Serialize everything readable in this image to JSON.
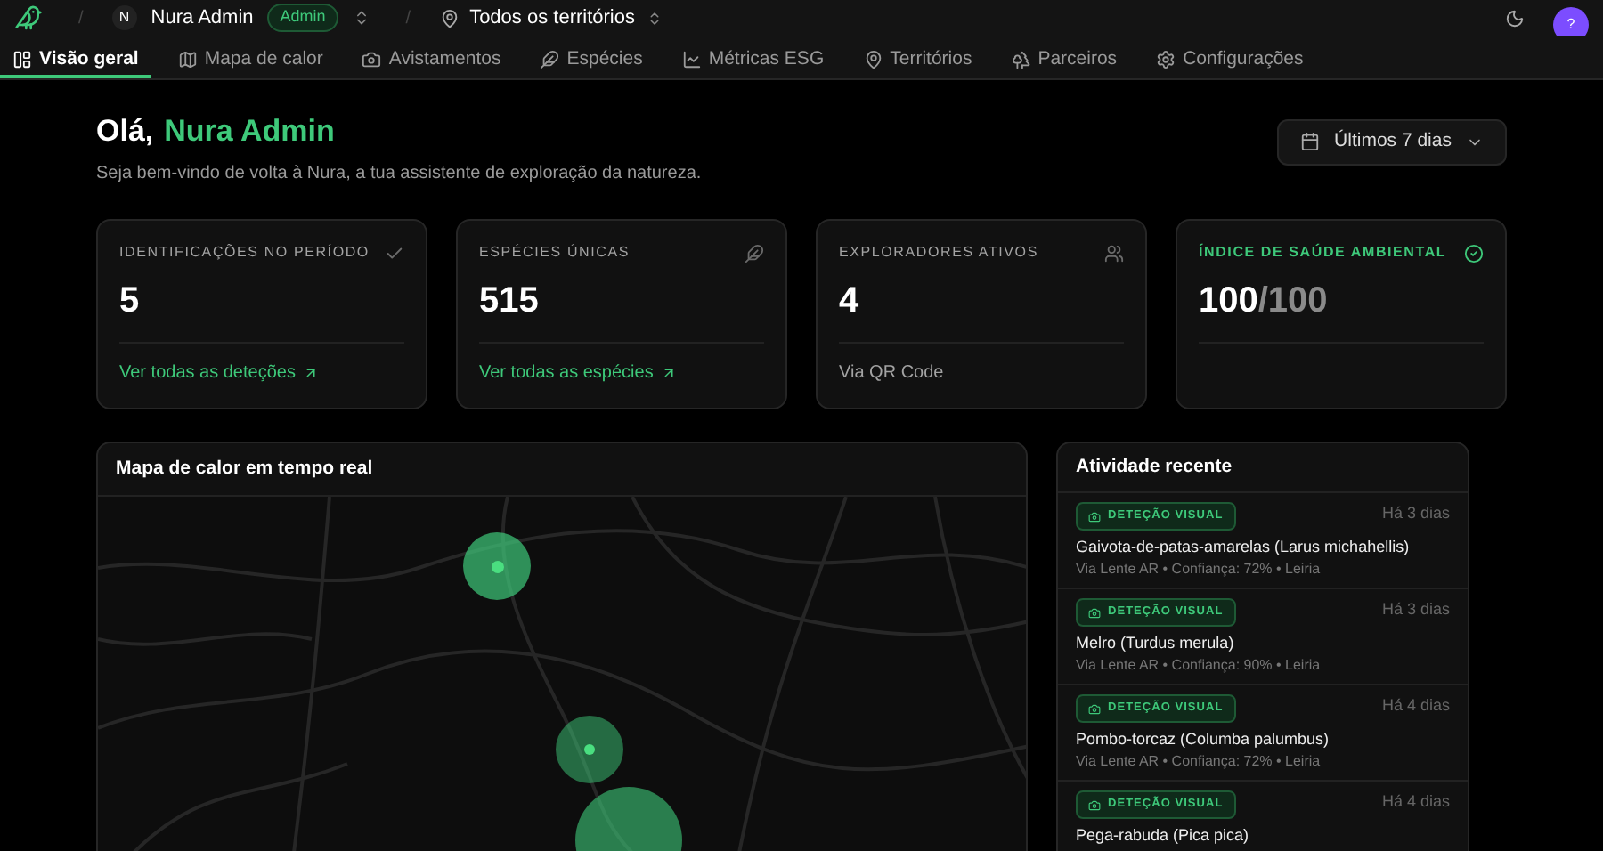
{
  "header": {
    "separator": "/",
    "user_initial": "N",
    "user_name": "Nura Admin",
    "role_badge": "Admin",
    "territory": "Todos os territórios",
    "avatar": "?"
  },
  "tabs": [
    {
      "label": "Visão geral",
      "selected": true
    },
    {
      "label": "Mapa de calor",
      "selected": false
    },
    {
      "label": "Avistamentos",
      "selected": false
    },
    {
      "label": "Espécies",
      "selected": false
    },
    {
      "label": "Métricas ESG",
      "selected": false
    },
    {
      "label": "Territórios",
      "selected": false
    },
    {
      "label": "Parceiros",
      "selected": false
    },
    {
      "label": "Configurações",
      "selected": false
    }
  ],
  "greeting": {
    "hello": "Olá,",
    "name": "Nura Admin",
    "subtitle": "Seja bem-vindo de volta à Nura, a tua assistente de exploração da natureza."
  },
  "period_select": {
    "value": "Últimos 7 dias"
  },
  "stat_cards": [
    {
      "kind": "link",
      "label": "IDENTIFICAÇÕES NO PERÍODO",
      "value": "5",
      "link": "Ver todas as deteções"
    },
    {
      "kind": "link",
      "label": "ESPÉCIES ÚNICAS",
      "value": "515",
      "link": "Ver todas as espécies"
    },
    {
      "kind": "note",
      "label": "EXPLORADORES ATIVOS",
      "value": "4",
      "note": "Via QR Code"
    },
    {
      "kind": "health",
      "label": "ÍNDICE DE SAÚDE AMBIENTAL",
      "value": "100",
      "suffix": "/100"
    }
  ],
  "heatmap": {
    "title": "Mapa de calor em tempo real"
  },
  "activity": {
    "title": "Atividade recente",
    "items": [
      {
        "badge": "DETEÇÃO VISUAL",
        "time": "Há 3 dias",
        "title": "Gaivota-de-patas-amarelas (Larus michahellis)",
        "meta": "Via Lente AR • Confiança: 72% • Leiria"
      },
      {
        "badge": "DETEÇÃO VISUAL",
        "time": "Há 3 dias",
        "title": "Melro (Turdus merula)",
        "meta": "Via Lente AR • Confiança: 90% • Leiria"
      },
      {
        "badge": "DETEÇÃO VISUAL",
        "time": "Há 4 dias",
        "title": "Pombo-torcaz (Columba palumbus)",
        "meta": "Via Lente AR • Confiança: 72% • Leiria"
      },
      {
        "badge": "DETEÇÃO VISUAL",
        "time": "Há 4 dias",
        "title": "Pega-rabuda (Pica pica)"
      }
    ]
  }
}
